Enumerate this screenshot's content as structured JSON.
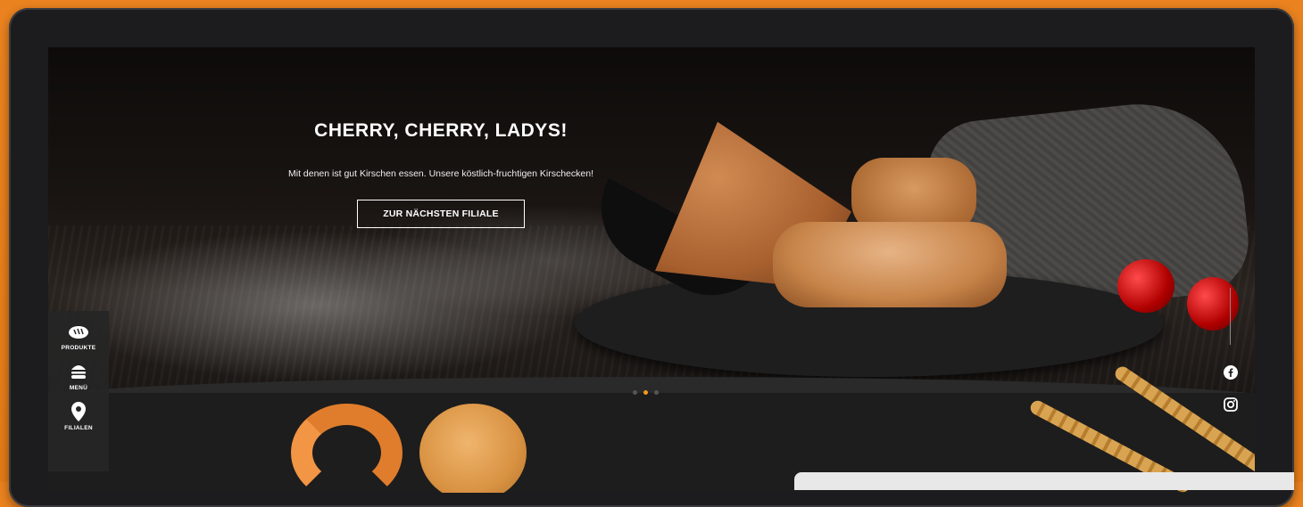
{
  "hero": {
    "title": "CHERRY, CHERRY, LADYS!",
    "subtitle": "Mit denen ist gut Kirschen essen. Unsere köstlich-fruchtigen Kirschecken!",
    "cta_label": "ZUR NÄCHSTEN FILIALE"
  },
  "slider": {
    "slide_count": 3,
    "active_index": 1
  },
  "sidebar": {
    "items": [
      {
        "label": "PRODUKTE",
        "icon": "bread-icon"
      },
      {
        "label": "MENÜ",
        "icon": "burger-icon"
      },
      {
        "label": "FILIALEN",
        "icon": "location-pin-icon"
      }
    ]
  },
  "social": {
    "items": [
      {
        "icon": "facebook-icon"
      },
      {
        "icon": "instagram-icon"
      }
    ]
  },
  "colors": {
    "accent": "#f39a1e",
    "background_frame": "#e27a17",
    "screen_dark": "#1d1d1d"
  }
}
